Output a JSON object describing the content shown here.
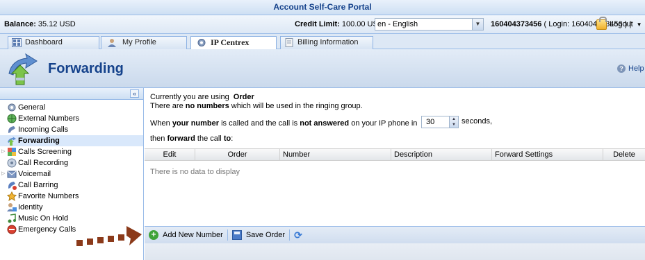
{
  "app": {
    "title": "Account Self-Care Portal"
  },
  "infobar": {
    "balance_label": "Balance:",
    "balance_value": "35.12 USD",
    "credit_label": "Credit Limit:",
    "credit_value": "100.00 USD",
    "language": "en - English",
    "account_number": "160404373456",
    "account_login": "( Login: 160404373456 )",
    "separator": "|",
    "logout_label": "Logout"
  },
  "tabs": [
    {
      "label": "Dashboard",
      "icon": "dashboard-icon",
      "active": false
    },
    {
      "label": "My Profile",
      "icon": "profile-icon",
      "active": false
    },
    {
      "label": "IP Centrex",
      "icon": "gear-icon",
      "active": true
    },
    {
      "label": "Billing Information",
      "icon": "document-icon",
      "active": false
    }
  ],
  "section": {
    "title": "Forwarding",
    "help_label": "Help"
  },
  "sidebar": {
    "collapse_glyph": "«",
    "items": [
      {
        "label": "General",
        "icon": "gear-icon",
        "selected": false,
        "expandable": false
      },
      {
        "label": "External Numbers",
        "icon": "globe-icon",
        "selected": false,
        "expandable": false
      },
      {
        "label": "Incoming Calls",
        "icon": "incoming-call-icon",
        "selected": false,
        "expandable": false
      },
      {
        "label": "Forwarding",
        "icon": "forwarding-icon",
        "selected": true,
        "expandable": false
      },
      {
        "label": "Calls Screening",
        "icon": "screening-icon",
        "selected": false,
        "expandable": true
      },
      {
        "label": "Call Recording",
        "icon": "recording-icon",
        "selected": false,
        "expandable": false
      },
      {
        "label": "Voicemail",
        "icon": "voicemail-icon",
        "selected": false,
        "expandable": true
      },
      {
        "label": "Call Barring",
        "icon": "barring-icon",
        "selected": false,
        "expandable": false
      },
      {
        "label": "Favorite Numbers",
        "icon": "favorite-icon",
        "selected": false,
        "expandable": false
      },
      {
        "label": "Identity",
        "icon": "identity-icon",
        "selected": false,
        "expandable": false
      },
      {
        "label": "Music On Hold",
        "icon": "music-icon",
        "selected": false,
        "expandable": false
      },
      {
        "label": "Emergency Calls",
        "icon": "emergency-icon",
        "selected": false,
        "expandable": false
      }
    ]
  },
  "main": {
    "line1_prefix": "Currently you are using",
    "line1_mode": "Order",
    "line2_a": "There are",
    "line2_b": "no numbers",
    "line2_c": "which will be used in the ringing group.",
    "line3_a": "When",
    "line3_b": "your number",
    "line3_c": "is called and the call is",
    "line3_d": "not answered",
    "line3_e": "on your IP phone in",
    "seconds_value": "30",
    "seconds_label": "seconds,",
    "line4_a": "then",
    "line4_b": "forward",
    "line4_c": "the call",
    "line4_d": "to",
    "line4_e": ":",
    "columns": [
      "Edit",
      "Order",
      "Number",
      "Description",
      "Forward Settings",
      "Delete"
    ],
    "empty_message": "There is no data to display",
    "toolbar": {
      "add_label": "Add New Number",
      "save_label": "Save Order"
    }
  },
  "colors": {
    "header_text": "#15428b",
    "border": "#99bbe8",
    "annotation_arrow": "#8b3a1a"
  }
}
